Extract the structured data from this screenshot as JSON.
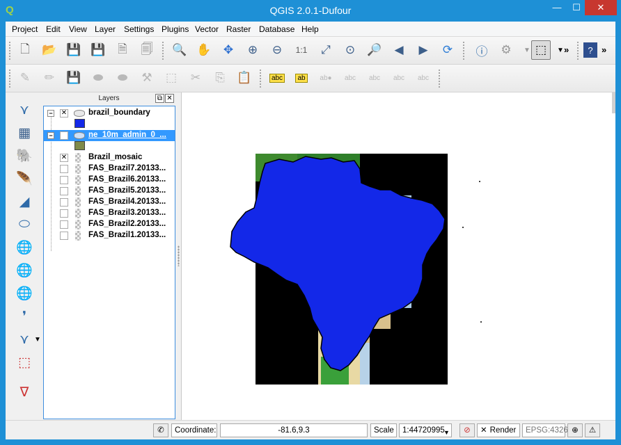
{
  "window": {
    "title": "QGIS 2.0.1-Dufour",
    "app_icon": "qgis-logo-icon",
    "minimize": "—",
    "maximize": "☐",
    "close": "✕"
  },
  "menu": [
    "Project",
    "Edit",
    "View",
    "Layer",
    "Settings",
    "Plugins",
    "Vector",
    "Raster",
    "Database",
    "Help"
  ],
  "toolbar_more": "»",
  "layers_panel": {
    "title": "Layers",
    "float_btn": "⧉",
    "close_btn": "✕",
    "layers": [
      {
        "name": "brazil_boundary",
        "checked": "✕",
        "expand": "−",
        "swatch": "#1328e8",
        "selected": false
      },
      {
        "name": "ne_10m_admin_0_...",
        "checked": "",
        "expand": "−",
        "swatch": "#7f8a4a",
        "selected": true
      },
      {
        "name": "Brazil_mosaic",
        "checked": "✕"
      },
      {
        "name": "FAS_Brazil7.20133...",
        "checked": ""
      },
      {
        "name": "FAS_Brazil6.20133...",
        "checked": ""
      },
      {
        "name": "FAS_Brazil5.20133...",
        "checked": ""
      },
      {
        "name": "FAS_Brazil4.20133...",
        "checked": ""
      },
      {
        "name": "FAS_Brazil3.20133...",
        "checked": ""
      },
      {
        "name": "FAS_Brazil2.20133...",
        "checked": ""
      },
      {
        "name": "FAS_Brazil1.20133...",
        "checked": ""
      }
    ]
  },
  "statusbar": {
    "coordinate_label": "Coordinate:",
    "coordinate_value": "-81.6,9.3",
    "scale_label": "Scale",
    "scale_value": "1:44720995",
    "render_label": "Render",
    "render_checked": "✕",
    "crs": "EPSG:4326"
  },
  "colors": {
    "title_bar": "#1e90d6",
    "boundary_fill": "#1328e8",
    "selection": "#3399ff"
  }
}
